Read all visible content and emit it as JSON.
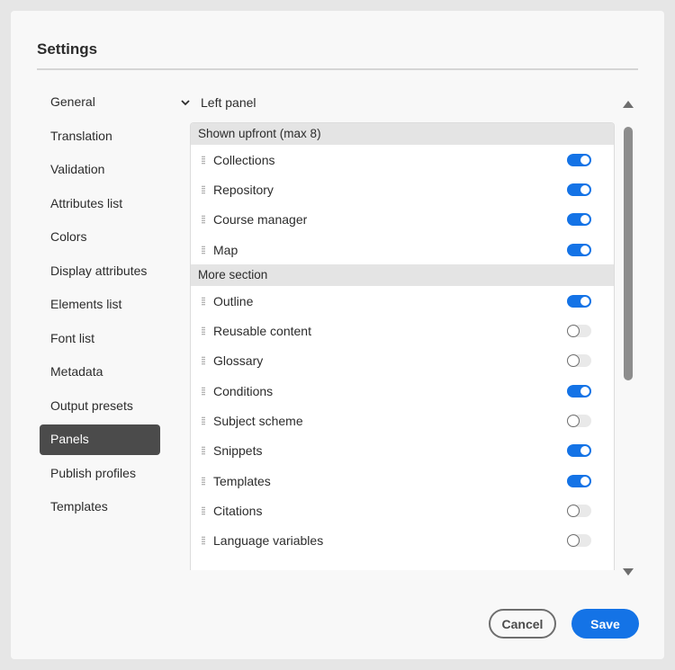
{
  "dialog": {
    "title": "Settings",
    "nav": [
      {
        "label": "General",
        "active": false
      },
      {
        "label": "Translation",
        "active": false
      },
      {
        "label": "Validation",
        "active": false
      },
      {
        "label": "Attributes list",
        "active": false
      },
      {
        "label": "Colors",
        "active": false
      },
      {
        "label": "Display attributes",
        "active": false
      },
      {
        "label": "Elements list",
        "active": false
      },
      {
        "label": "Font list",
        "active": false
      },
      {
        "label": "Metadata",
        "active": false
      },
      {
        "label": "Output presets",
        "active": false
      },
      {
        "label": "Panels",
        "active": true
      },
      {
        "label": "Publish profiles",
        "active": false
      },
      {
        "label": "Templates",
        "active": false
      }
    ],
    "panel_group": {
      "label": "Left panel",
      "icon": "chevron-down-icon",
      "shown_section": {
        "title": "Shown upfront (max 8)",
        "items": [
          {
            "label": "Collections",
            "enabled": true
          },
          {
            "label": "Repository",
            "enabled": true
          },
          {
            "label": "Course manager",
            "enabled": true
          },
          {
            "label": "Map",
            "enabled": true
          }
        ]
      },
      "more_section": {
        "title": "More section",
        "items": [
          {
            "label": "Outline",
            "enabled": true
          },
          {
            "label": "Reusable content",
            "enabled": false
          },
          {
            "label": "Glossary",
            "enabled": false
          },
          {
            "label": "Conditions",
            "enabled": true
          },
          {
            "label": "Subject scheme",
            "enabled": false
          },
          {
            "label": "Snippets",
            "enabled": true
          },
          {
            "label": "Templates",
            "enabled": true
          },
          {
            "label": "Citations",
            "enabled": false
          },
          {
            "label": "Language variables",
            "enabled": false
          }
        ]
      }
    },
    "footer": {
      "cancel_label": "Cancel",
      "save_label": "Save"
    },
    "colors": {
      "accent": "#1473e6",
      "active_nav": "#4b4b4b"
    }
  }
}
